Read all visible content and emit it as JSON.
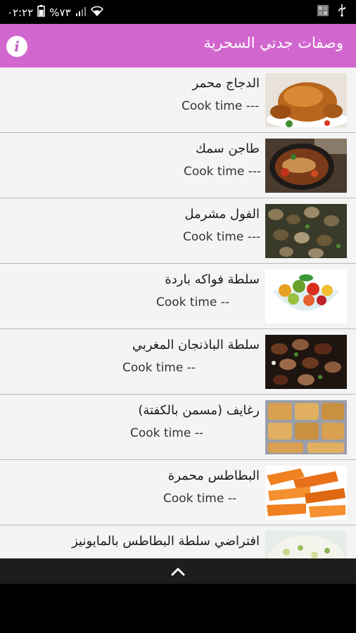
{
  "status_bar": {
    "time": "٠٢:٢٢",
    "battery": "%٧٣"
  },
  "app_bar": {
    "title": "وصفات جدتي السحرية",
    "info_icon": "i"
  },
  "recipes": [
    {
      "name": "الدجاج محمر",
      "cook_time": "Cook time ---"
    },
    {
      "name": "طاجن سمك",
      "cook_time": "Cook time ---"
    },
    {
      "name": "الفول مشرمل",
      "cook_time": "Cook time ---"
    },
    {
      "name": "سلطة فواكه باردة",
      "cook_time": "Cook time --"
    },
    {
      "name": "سلطة الباذنجان المغربي",
      "cook_time": "Cook time --"
    },
    {
      "name": "رغايف (مسمن بالكفتة)",
      "cook_time": "Cook time --"
    },
    {
      "name": "البطاطس محمرة",
      "cook_time": "Cook time --"
    },
    {
      "name": "افتراضي سلطة البطاطس بالمايونيز",
      "cook_time": ""
    }
  ],
  "colors": {
    "app_bar": "#d166cf",
    "list_bg": "#f4f4f4",
    "divider": "#b8b8b8"
  }
}
